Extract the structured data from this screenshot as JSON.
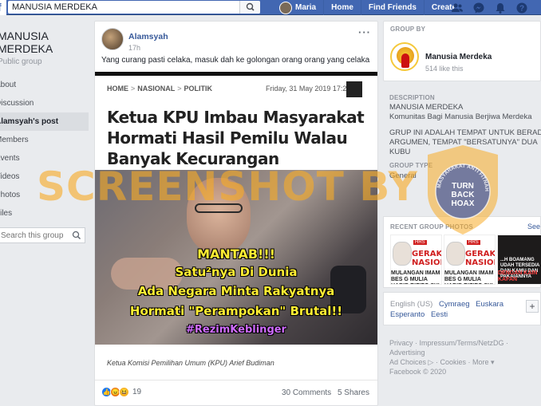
{
  "topbar": {
    "search_value": "MANUSIA MERDEKA",
    "user_name": "Maria",
    "links": [
      "Home",
      "Find Friends",
      "Create"
    ],
    "icons": [
      "friends-icon",
      "messenger-icon",
      "notifications-icon",
      "help-icon"
    ]
  },
  "left": {
    "group_name": "MANUSIA MERDEKA",
    "group_type": "Public group",
    "menu": [
      "About",
      "Discussion",
      "Alamsyah's post",
      "Members",
      "Events",
      "Videos",
      "Photos",
      "Files"
    ],
    "search_placeholder": "Search this group"
  },
  "post": {
    "author": "Alamsyah",
    "time": "17h",
    "text": "Yang curang pasti celaka, masuk dah ke golongan orang orang yang celaka",
    "article": {
      "crumb_home": "HOME",
      "crumb_nasional": "NASIONAL",
      "crumb_politik": "POLITIK",
      "date": "Friday, 31 May 2019 17:2",
      "title": "Ketua KPU Imbau Masyarakat Hormati Hasil Pemilu Walau Banyak Kecurangan",
      "overlay_lines": [
        "MANTAB!!!",
        "Satu²nya Di Dunia",
        "Ada Negara Minta Rakyatnya",
        "Hormati \"Perampokan\" Brutal!!",
        "#RezimKeblinger"
      ],
      "photo_caption": "Ketua Komisi Pemilihan Umum (KPU) Arief Budiman"
    },
    "reaction_count": "19",
    "comments": "30 Comments",
    "shares": "5 Shares"
  },
  "right": {
    "group_by_head": "GROUP BY",
    "group_by_name": "Manusia Merdeka",
    "group_by_likes": "514 like this",
    "description_head": "DESCRIPTION",
    "description_lines": [
      "MANUSIA MERDEKA",
      "Komunitas Bagi Manusia Berjiwa Merdeka",
      "",
      "GRUP INI ADALAH TEMPAT UNTUK BERADU",
      "ARGUMEN, TEMPAT \"BERSATUNYA\" DUA",
      "KUBU"
    ],
    "group_type_head": "GROUP TYPE",
    "group_type": "General",
    "photos_head": "RECENT GROUP PHOTOS",
    "see_all": "See",
    "thumb1_red": "GERAKA NASIONA",
    "thumb1_line": "MULANGAN IMAM BES G MULIA HABIB RIZIEQ SYI",
    "thumb1_badge": "HRS",
    "thumb2_red": "GERAKA NASIONA",
    "thumb2_line": "MULANGAN IMAM BES G MULIA HABIB RIZIEQ SYI",
    "thumb3_line": "DENGAN KAIN KAFAN",
    "thumb3_line2": "...H BOAMANG\nUDAH TERSEDIA\nDAN KAMU DAN\nPAKAIANNYA",
    "lang_current": "English (US)",
    "lang_links_row1": [
      "Cymraeg",
      "Euskara"
    ],
    "lang_row2": [
      "Esperanto",
      "Eesti"
    ],
    "footer_lines": [
      "Privacy · Impressum/Terms/NetzDG · Advertising",
      "Ad Choices ▷ · Cookies · More ▾",
      "Facebook © 2020"
    ]
  },
  "overlay": {
    "watermark": "SCREENSHOT BY",
    "seal_ring": "MASYARAKAT ANTI FITNAH INDONESIA",
    "seal_text": [
      "TURN",
      "BACK",
      "HOAX"
    ]
  },
  "colors": {
    "fb_blue": "#4267b2",
    "link_blue": "#365899",
    "watermark_orange": "#f7ab26"
  }
}
